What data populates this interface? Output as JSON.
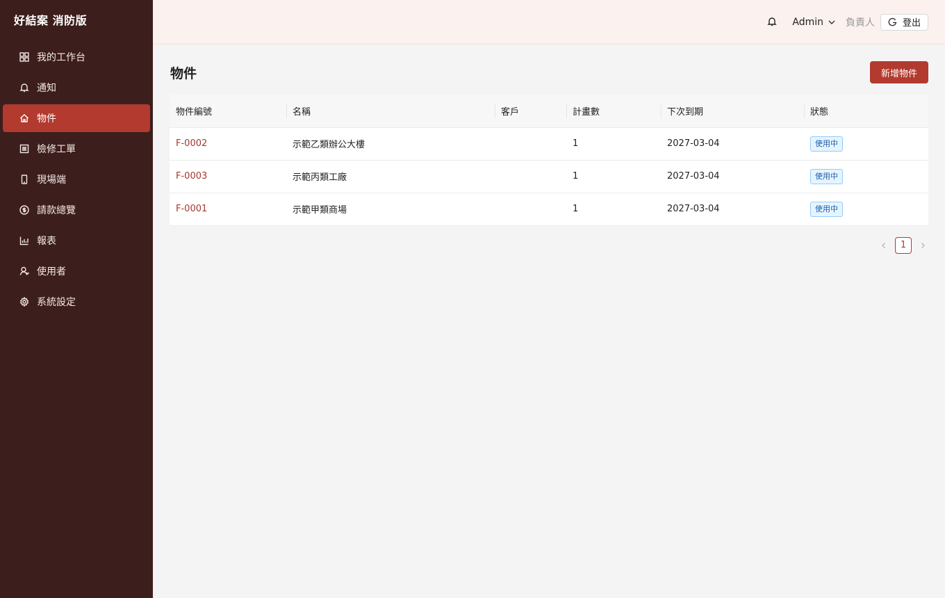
{
  "app": {
    "title": "好結案 消防版"
  },
  "sidebar": {
    "items": [
      {
        "label": "我的工作台",
        "icon": "dashboard-icon"
      },
      {
        "label": "通知",
        "icon": "bell-icon"
      },
      {
        "label": "物件",
        "icon": "home-icon",
        "active": true
      },
      {
        "label": "檢修工單",
        "icon": "list-icon"
      },
      {
        "label": "現場端",
        "icon": "mobile-icon"
      },
      {
        "label": "請款總覽",
        "icon": "dollar-icon"
      },
      {
        "label": "報表",
        "icon": "bar-chart-icon"
      },
      {
        "label": "使用者",
        "icon": "user-icon"
      },
      {
        "label": "系統設定",
        "icon": "gear-icon"
      }
    ]
  },
  "header": {
    "user": "Admin",
    "role": "負責人",
    "logout_label": "登出"
  },
  "main": {
    "title": "物件",
    "add_button": "新增物件"
  },
  "table": {
    "columns": [
      "物件編號",
      "名稱",
      "客戶",
      "計畫數",
      "下次到期",
      "狀態"
    ],
    "rows": [
      {
        "code": "F-0002",
        "name": "示範乙類辦公大樓",
        "client": "",
        "plans": "1",
        "due": "2027-03-04",
        "status": "使用中"
      },
      {
        "code": "F-0003",
        "name": "示範丙類工廠",
        "client": "",
        "plans": "1",
        "due": "2027-03-04",
        "status": "使用中"
      },
      {
        "code": "F-0001",
        "name": "示範甲類商場",
        "client": "",
        "plans": "1",
        "due": "2027-03-04",
        "status": "使用中"
      }
    ]
  },
  "pagination": {
    "current": "1"
  },
  "colors": {
    "sidebar_bg": "#3c1e1c",
    "accent": "#b23a2f",
    "header_bg": "#fbf1ef",
    "badge_blue": "#1c5fa8"
  }
}
